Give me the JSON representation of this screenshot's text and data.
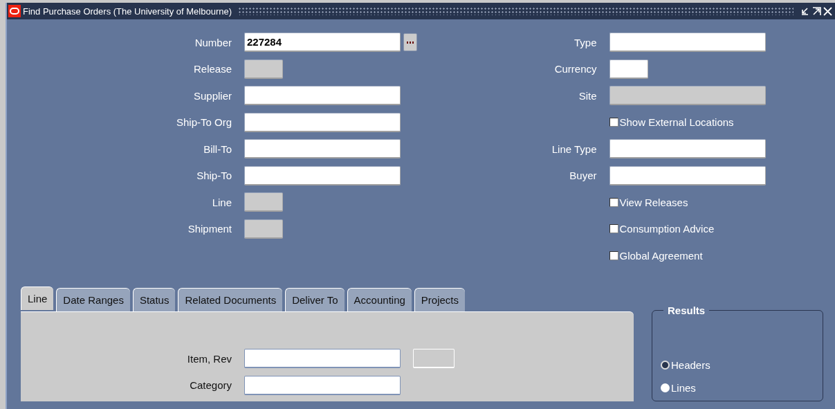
{
  "window": {
    "title": "Find Purchase Orders (The University of Melbourne)"
  },
  "left_fields": [
    {
      "label": "Number",
      "kind": "lov",
      "value": "227284",
      "disabled": false
    },
    {
      "label": "Release",
      "kind": "short",
      "disabled": true
    },
    {
      "label": "Supplier",
      "kind": "text",
      "disabled": false
    },
    {
      "label": "Ship-To Org",
      "kind": "text",
      "disabled": false
    },
    {
      "label": "Bill-To",
      "kind": "text",
      "disabled": false
    },
    {
      "label": "Ship-To",
      "kind": "text",
      "disabled": false
    },
    {
      "label": "Line",
      "kind": "short",
      "disabled": true
    },
    {
      "label": "Shipment",
      "kind": "short",
      "disabled": true
    }
  ],
  "right_fields": [
    {
      "label": "Type",
      "kind": "text",
      "disabled": false
    },
    {
      "label": "Currency",
      "kind": "short",
      "disabled": false
    },
    {
      "label": "Site",
      "kind": "text",
      "disabled": true
    },
    {
      "label": "Show External Locations",
      "kind": "checkbox",
      "checked": false
    },
    {
      "label": "Line Type",
      "kind": "text",
      "disabled": false
    },
    {
      "label": "Buyer",
      "kind": "text",
      "disabled": false
    },
    {
      "label": "View Releases",
      "kind": "checkbox",
      "checked": false
    },
    {
      "label": "Consumption Advice",
      "kind": "checkbox",
      "checked": false
    },
    {
      "label": "Global Agreement",
      "kind": "checkbox",
      "checked": false
    }
  ],
  "tabs": [
    {
      "label": "Line",
      "selected": true
    },
    {
      "label": "Date Ranges",
      "selected": false
    },
    {
      "label": "Status",
      "selected": false
    },
    {
      "label": "Related Documents",
      "selected": false
    },
    {
      "label": "Deliver To",
      "selected": false
    },
    {
      "label": "Accounting",
      "selected": false
    },
    {
      "label": "Projects",
      "selected": false
    }
  ],
  "tab_fields": [
    {
      "label": "Item, Rev",
      "kind": "pair"
    },
    {
      "label": "Category",
      "kind": "single"
    }
  ],
  "results": {
    "title": "Results",
    "options": [
      {
        "label": "Headers",
        "selected": true
      },
      {
        "label": "Lines",
        "selected": false
      }
    ]
  }
}
